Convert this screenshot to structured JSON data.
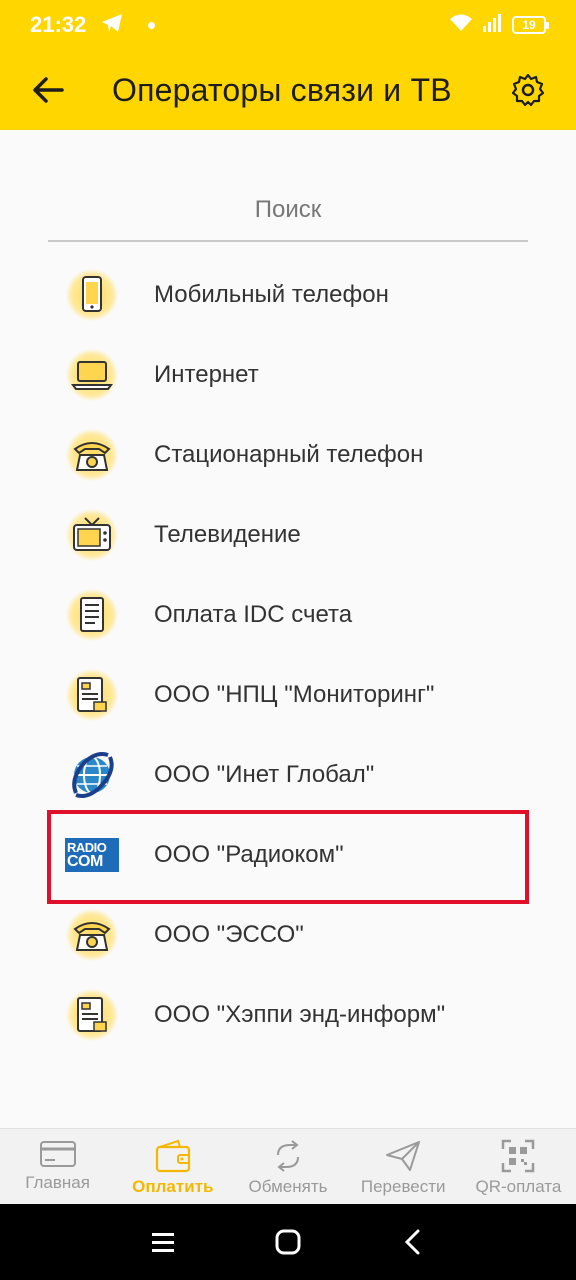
{
  "status": {
    "time": "21:32",
    "battery": "19"
  },
  "header": {
    "title": "Операторы связи и ТВ"
  },
  "search": {
    "placeholder": "Поиск"
  },
  "list": {
    "items": [
      {
        "label": "Мобильный телефон",
        "icon": "mobile-phone-icon"
      },
      {
        "label": "Интернет",
        "icon": "laptop-icon"
      },
      {
        "label": "Стационарный телефон",
        "icon": "landline-phone-icon"
      },
      {
        "label": "Телевидение",
        "icon": "tv-icon"
      },
      {
        "label": "Оплата IDC счета",
        "icon": "invoice-icon"
      },
      {
        "label": "ООО \"НПЦ \"Мониторинг\"",
        "icon": "document-icon"
      },
      {
        "label": "ООО \"Инет Глобал\"",
        "icon": "globe-icon"
      },
      {
        "label": "ООО \"Радиоком\"",
        "icon": "radiocom-logo",
        "logo_text_top": "RADIO",
        "logo_text_bottom": "COM"
      },
      {
        "label": "ООО \"ЭССО\"",
        "icon": "landline-phone-icon"
      },
      {
        "label": "ООО \"Хэппи энд-информ\"",
        "icon": "document-icon"
      }
    ]
  },
  "nav": {
    "items": [
      {
        "label": "Главная",
        "icon": "card-icon",
        "active": false
      },
      {
        "label": "Оплатить",
        "icon": "wallet-icon",
        "active": true
      },
      {
        "label": "Обменять",
        "icon": "exchange-icon",
        "active": false
      },
      {
        "label": "Перевести",
        "icon": "send-icon",
        "active": false
      },
      {
        "label": "QR-оплата",
        "icon": "qr-icon",
        "active": false
      }
    ]
  },
  "colors": {
    "accent": "#ffd600",
    "active_nav": "#f5b800",
    "highlight": "#e0102a"
  }
}
